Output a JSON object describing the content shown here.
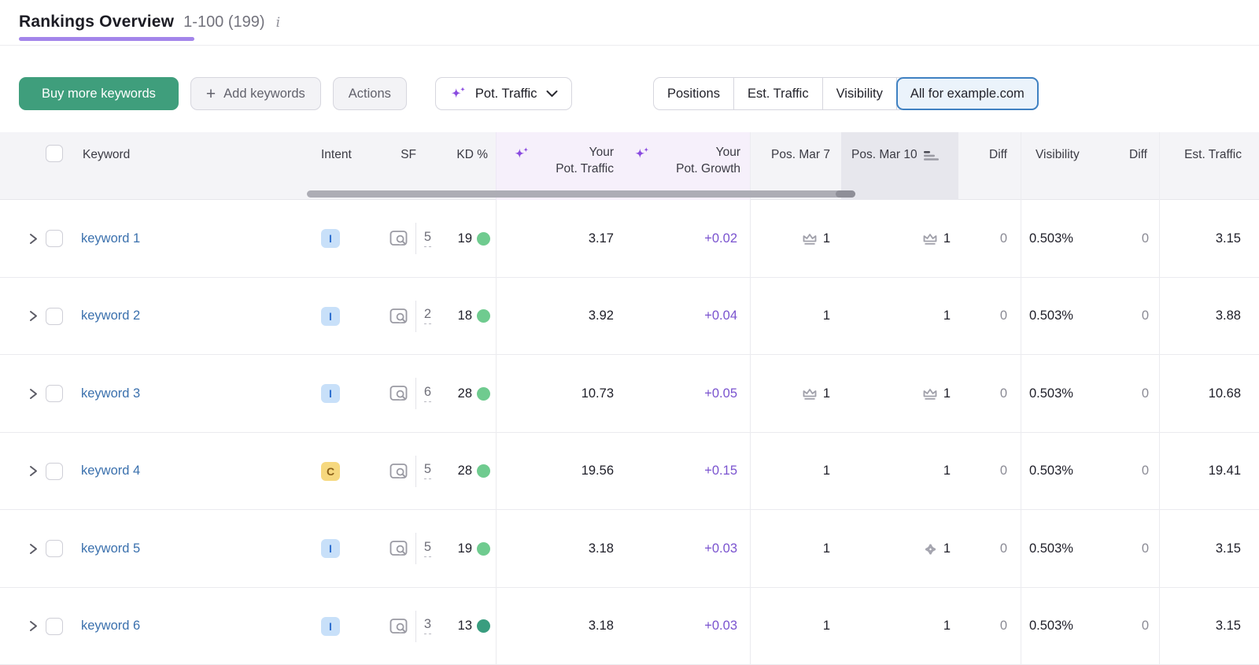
{
  "header": {
    "title": "Rankings Overview",
    "range": "1-100 (199)",
    "info_icon": "i"
  },
  "toolbar": {
    "buy_button": "Buy more keywords",
    "add_button": "Add keywords",
    "add_plus": "+",
    "actions_button": "Actions",
    "metric_dropdown": "Pot. Traffic",
    "view_tabs": [
      {
        "label": "Positions",
        "selected": false
      },
      {
        "label": "Est. Traffic",
        "selected": false
      },
      {
        "label": "Visibility",
        "selected": false
      },
      {
        "label": "All for example.com",
        "selected": true
      }
    ]
  },
  "table": {
    "columns": {
      "keyword": "Keyword",
      "intent": "Intent",
      "sf": "SF",
      "kd": "KD %",
      "pot_traffic_line1": "Your",
      "pot_traffic_line2": "Pot. Traffic",
      "pot_growth_line1": "Your",
      "pot_growth_line2": "Pot. Growth",
      "pos_mar7": "Pos. Mar 7",
      "pos_mar10": "Pos. Mar 10",
      "diff1": "Diff",
      "visibility": "Visibility",
      "diff2": "Diff",
      "est_traffic": "Est. Traffic"
    },
    "rows": [
      {
        "keyword": "keyword 1",
        "intent": "I",
        "sf": "5",
        "kd": "19",
        "kd_level": "light",
        "pot_traffic": "3.17",
        "pot_growth": "+0.02",
        "pos7": "1",
        "pos7_crown": true,
        "pos10": "1",
        "pos10_crown": true,
        "pos10_clover": false,
        "diff1": "0",
        "visibility": "0.503%",
        "diff2": "0",
        "est_traffic": "3.15"
      },
      {
        "keyword": "keyword 2",
        "intent": "I",
        "sf": "2",
        "kd": "18",
        "kd_level": "light",
        "pot_traffic": "3.92",
        "pot_growth": "+0.04",
        "pos7": "1",
        "pos7_crown": false,
        "pos10": "1",
        "pos10_crown": false,
        "pos10_clover": false,
        "diff1": "0",
        "visibility": "0.503%",
        "diff2": "0",
        "est_traffic": "3.88"
      },
      {
        "keyword": "keyword 3",
        "intent": "I",
        "sf": "6",
        "kd": "28",
        "kd_level": "light",
        "pot_traffic": "10.73",
        "pot_growth": "+0.05",
        "pos7": "1",
        "pos7_crown": true,
        "pos10": "1",
        "pos10_crown": true,
        "pos10_clover": false,
        "diff1": "0",
        "visibility": "0.503%",
        "diff2": "0",
        "est_traffic": "10.68"
      },
      {
        "keyword": "keyword 4",
        "intent": "C",
        "sf": "5",
        "kd": "28",
        "kd_level": "light",
        "pot_traffic": "19.56",
        "pot_growth": "+0.15",
        "pos7": "1",
        "pos7_crown": false,
        "pos10": "1",
        "pos10_crown": false,
        "pos10_clover": false,
        "diff1": "0",
        "visibility": "0.503%",
        "diff2": "0",
        "est_traffic": "19.41"
      },
      {
        "keyword": "keyword 5",
        "intent": "I",
        "sf": "5",
        "kd": "19",
        "kd_level": "light",
        "pot_traffic": "3.18",
        "pot_growth": "+0.03",
        "pos7": "1",
        "pos7_crown": false,
        "pos10": "1",
        "pos10_crown": false,
        "pos10_clover": true,
        "diff1": "0",
        "visibility": "0.503%",
        "diff2": "0",
        "est_traffic": "3.15"
      },
      {
        "keyword": "keyword 6",
        "intent": "I",
        "sf": "3",
        "kd": "13",
        "kd_level": "dark",
        "pot_traffic": "3.18",
        "pot_growth": "+0.03",
        "pos7": "1",
        "pos7_crown": false,
        "pos10": "1",
        "pos10_crown": false,
        "pos10_clover": false,
        "diff1": "0",
        "visibility": "0.503%",
        "diff2": "0",
        "est_traffic": "3.15"
      }
    ]
  },
  "colors": {
    "accent_purple_underline": "#a385ea",
    "sparkle_purple": "#8a4be0",
    "growth_purple": "#7a53cf",
    "green_button": "#3f9e7c",
    "link_blue": "#3a70ad",
    "selected_tab_border": "#3f81c2",
    "selected_tab_bg": "#ebf3fb",
    "intent_i_bg": "#c8e0f9",
    "intent_i_text": "#2d6fd0",
    "intent_c_bg": "#f6d87e",
    "intent_c_text": "#8a6019",
    "kd_dot_easy": "#6fcb8f",
    "kd_dot_very_easy": "#399d7f",
    "header_bg": "#f4f4f7",
    "header_purple_bg": "#f6f0fb",
    "sorted_col_bg": "#e7e7ed"
  }
}
